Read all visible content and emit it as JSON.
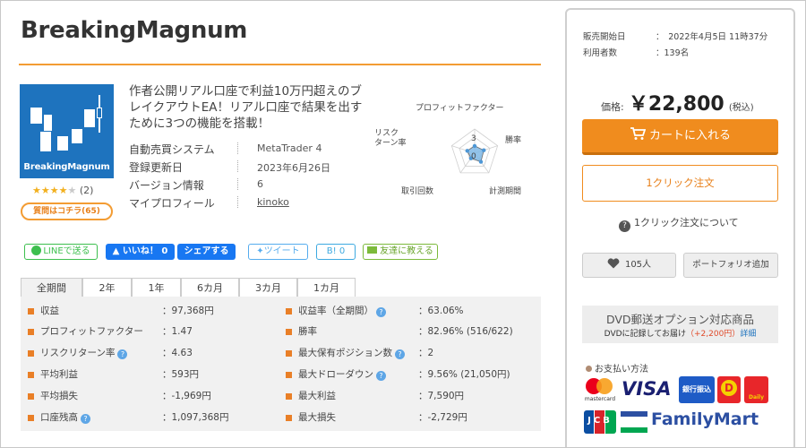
{
  "product": {
    "title": "BreakingMagnum",
    "image_text": "BreakingMagnum",
    "rating_stars": 4,
    "rating_max": 5,
    "review_count": "(2)",
    "question_button": "質問はコチラ(65)",
    "tagline": "作者公開リアル口座で利益10万円超えのブレイクアウトEA！リアル口座で結果を出すために3つの機能を搭載！"
  },
  "info": [
    {
      "label": "自動売買システム",
      "value": "MetaTrader 4"
    },
    {
      "label": "登録更新日",
      "value": "2023年6月26日"
    },
    {
      "label": "バージョン情報",
      "value": "6"
    },
    {
      "label": "マイプロフィール",
      "value": "kinoko"
    }
  ],
  "radar": {
    "axes": [
      "プロフィットファクター",
      "勝率",
      "計測期間",
      "取引回数",
      "リスクターン率"
    ],
    "axis_lines": [
      [
        "プロフィットファクター"
      ],
      [
        "勝率"
      ],
      [
        "計測期間"
      ],
      [
        "取引回数"
      ],
      [
        "リスク",
        "ターン率"
      ]
    ],
    "scale_labels": [
      "3",
      "0"
    ],
    "values": [
      1.5,
      2.0,
      2.2,
      1.3,
      1.6
    ],
    "max": 5,
    "fill": "#7fb8e6",
    "stroke": "#6a6a6a"
  },
  "share": {
    "line": "LINEで送る",
    "like": "いいね！ 0",
    "share": "シェアする",
    "tweet": "ツイート",
    "hatena": "B! 0",
    "friend": "友達に教える"
  },
  "tabs": [
    "全期間",
    "2年",
    "1年",
    "6カ月",
    "3カ月",
    "1カ月"
  ],
  "stats_left": [
    {
      "label": "収益",
      "value": "：97,368円",
      "help": false
    },
    {
      "label": "プロフィットファクター",
      "value": "：1.47",
      "help": false
    },
    {
      "label": "リスクリターン率",
      "value": "：4.63",
      "help": true
    },
    {
      "label": "平均利益",
      "value": "：593円",
      "help": false
    },
    {
      "label": "平均損失",
      "value": "：-1,969円",
      "help": false
    },
    {
      "label": "口座残高",
      "value": "：1,097,368円",
      "help": true
    }
  ],
  "stats_right": [
    {
      "label": "収益率（全期間）",
      "value": "：63.06%",
      "help": true
    },
    {
      "label": "勝率",
      "value": "：82.96% (516/622)",
      "help": false
    },
    {
      "label": "最大保有ポジション数",
      "value": "：2",
      "help": true
    },
    {
      "label": "最大ドローダウン",
      "value": "：9.56% (21,050円)",
      "help": true
    },
    {
      "label": "最大利益",
      "value": "：7,590円",
      "help": false
    },
    {
      "label": "最大損失",
      "value": "：-2,729円",
      "help": false
    }
  ],
  "sidebar": {
    "release_label": "販売開始日",
    "release_value": "：　2022年4月5日 11時37分",
    "users_label": "利用者数",
    "users_value": "：139名",
    "price_label": "価格:",
    "price_amount": "￥22,800",
    "price_tax": "(税込)",
    "cart_button": "カートに入れる",
    "oneclick_button": "1クリック注文",
    "oneclick_help_icon": "?",
    "oneclick_help": "1クリック注文について",
    "fav_count": "105人",
    "portfolio_button": "ポートフォリオ追加",
    "dvd_title": "DVD郵送オプション対応商品",
    "dvd_note_prefix": "DVDに記録してお届け",
    "dvd_note_price": "（+2,200円）",
    "dvd_note_link": "詳細",
    "payment_title": "お支払い方法"
  },
  "payment_logos": {
    "mastercard": "mastercard",
    "visa": "VISA",
    "bank": "銀行振込",
    "daily": "Daily",
    "jcb": "JCB",
    "familymart": "FamilyMart"
  },
  "colors": {
    "accent": "#f08c1e",
    "title_rule": "#f39c33",
    "image_bg": "#1e73be",
    "link": "#1e73be",
    "facebook": "#1877f2",
    "line": "#3dbf4e",
    "twitter": "#55acee"
  },
  "icons": {
    "cart": "cart-icon",
    "heart": "heart-icon",
    "help": "question-circle-icon",
    "line": "line-logo-icon",
    "thumb": "thumbs-up-icon",
    "bird": "twitter-bird-icon",
    "mail": "mail-icon"
  }
}
